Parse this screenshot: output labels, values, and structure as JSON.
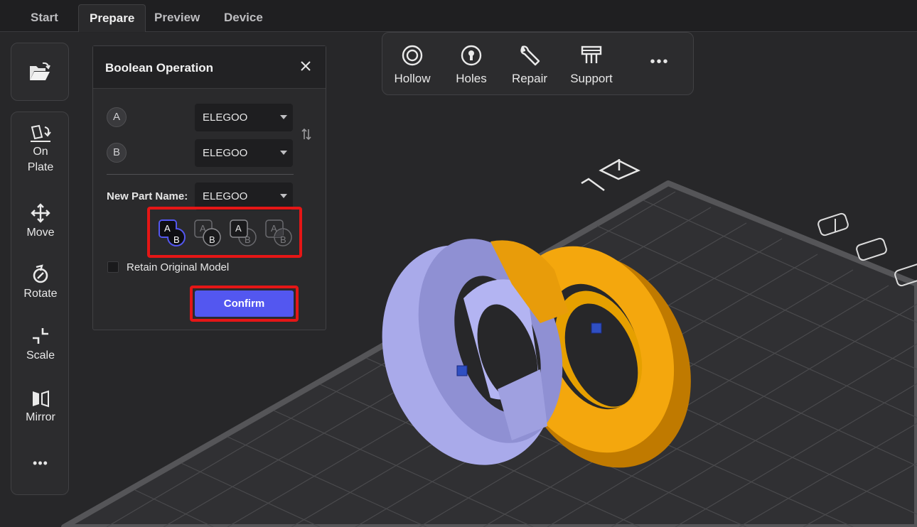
{
  "tabs": [
    "Start",
    "Prepare",
    "Preview",
    "Device"
  ],
  "active_tab": "Prepare",
  "left_tools": [
    {
      "label_lines": [
        "On",
        "Plate"
      ],
      "icon": "lay-on-plate-icon"
    },
    {
      "label_lines": [
        "Move"
      ],
      "icon": "move-icon"
    },
    {
      "label_lines": [
        "Rotate"
      ],
      "icon": "rotate-icon"
    },
    {
      "label_lines": [
        "Scale"
      ],
      "icon": "scale-icon"
    },
    {
      "label_lines": [
        "Mirror"
      ],
      "icon": "mirror-icon"
    }
  ],
  "left_more": "•••",
  "top_tools": [
    {
      "label": "Hollow",
      "icon": "hollow-icon"
    },
    {
      "label": "Holes",
      "icon": "holes-icon"
    },
    {
      "label": "Repair",
      "icon": "repair-wrench-icon"
    },
    {
      "label": "Support",
      "icon": "support-icon"
    }
  ],
  "top_more": "•••",
  "dialog": {
    "title": "Boolean Operation",
    "part_a_tag": "A",
    "part_b_tag": "B",
    "part_a_value": "ELEGOO",
    "part_b_value": "ELEGOO",
    "new_part_label": "New Part Name:",
    "new_part_value": "ELEGOO",
    "operations": [
      {
        "a": "A",
        "b": "B",
        "name": "union",
        "selected": true
      },
      {
        "a": "A",
        "b": "B",
        "name": "subtract-a-from-b",
        "selected": false
      },
      {
        "a": "A",
        "b": "B",
        "name": "subtract-b-from-a",
        "selected": false
      },
      {
        "a": "A",
        "b": "B",
        "name": "intersection",
        "selected": false
      }
    ],
    "retain_label": "Retain Original Model",
    "retain_checked": false,
    "confirm_label": "Confirm"
  },
  "colors": {
    "accent": "#5357f0",
    "highlight": "#e51616",
    "model_a": "#b3b4f2",
    "model_b": "#f4a70d"
  }
}
